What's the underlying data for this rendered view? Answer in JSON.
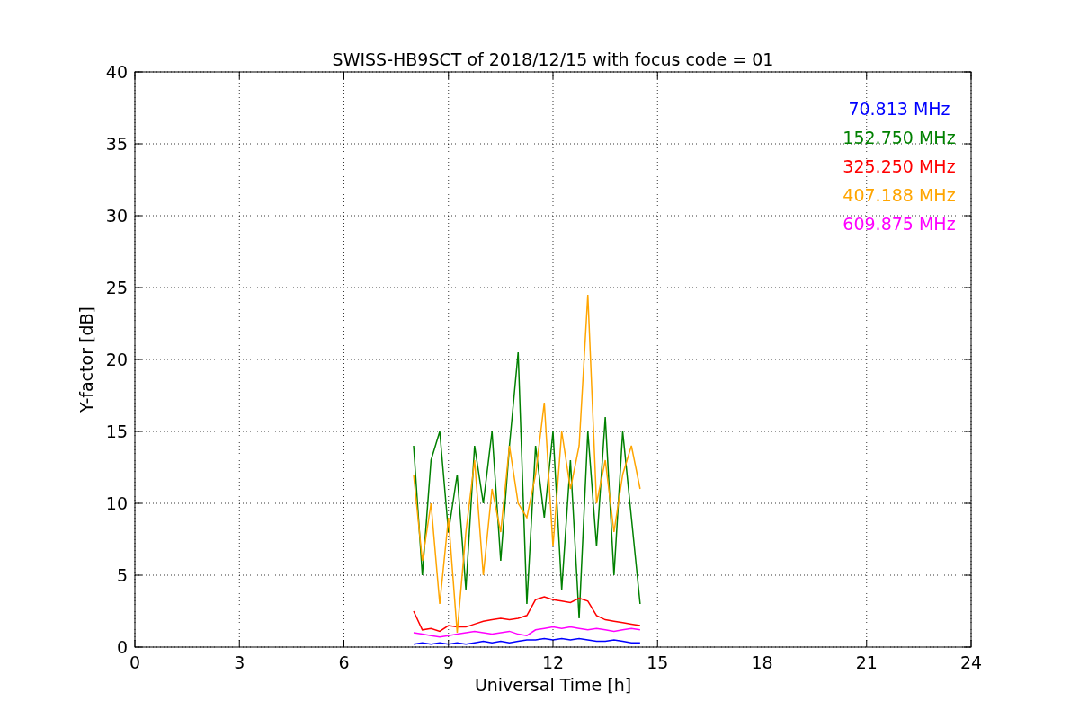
{
  "chart_data": {
    "type": "line",
    "title": "SWISS-HB9SCT of 2018/12/15 with focus code = 01",
    "xlabel": "Universal Time [h]",
    "ylabel": "Y-factor [dB]",
    "xlim": [
      0,
      24
    ],
    "ylim": [
      0,
      40
    ],
    "xticks": [
      0,
      3,
      6,
      9,
      12,
      15,
      18,
      21,
      24
    ],
    "yticks": [
      0,
      5,
      10,
      15,
      20,
      25,
      30,
      35,
      40
    ],
    "grid": true,
    "x": [
      8,
      8.25,
      8.5,
      8.75,
      9,
      9.25,
      9.5,
      9.75,
      10,
      10.25,
      10.5,
      10.75,
      11,
      11.25,
      11.5,
      11.75,
      12,
      12.25,
      12.5,
      12.75,
      13,
      13.25,
      13.5,
      13.75,
      14,
      14.25,
      14.5
    ],
    "series": [
      {
        "name": "70.813 MHz",
        "color": "#0000ff",
        "values": [
          0.2,
          0.3,
          0.2,
          0.3,
          0.2,
          0.3,
          0.2,
          0.3,
          0.4,
          0.3,
          0.4,
          0.3,
          0.4,
          0.5,
          0.5,
          0.6,
          0.5,
          0.6,
          0.5,
          0.6,
          0.5,
          0.4,
          0.4,
          0.5,
          0.4,
          0.3,
          0.3
        ]
      },
      {
        "name": "152.750 MHz",
        "color": "#008000",
        "values": [
          14,
          5,
          13,
          15,
          8,
          12,
          4,
          14,
          10,
          15,
          6,
          14,
          20.5,
          3,
          14,
          9,
          15,
          4,
          13,
          2,
          15,
          7,
          16,
          5,
          15,
          9,
          3
        ]
      },
      {
        "name": "325.250 MHz",
        "color": "#ff0000",
        "values": [
          2.5,
          1.2,
          1.3,
          1.1,
          1.5,
          1.4,
          1.4,
          1.6,
          1.8,
          1.9,
          2.0,
          1.9,
          2.0,
          2.2,
          3.3,
          3.5,
          3.3,
          3.2,
          3.1,
          3.4,
          3.2,
          2.2,
          1.9,
          1.8,
          1.7,
          1.6,
          1.5
        ]
      },
      {
        "name": "407.188 MHz",
        "color": "#ffa500",
        "values": [
          12,
          6,
          10,
          3,
          9,
          1,
          8,
          13,
          5,
          11,
          8,
          14,
          10,
          9,
          12,
          17,
          7,
          15,
          11,
          14,
          24.5,
          10,
          13,
          8,
          12,
          14,
          11
        ]
      },
      {
        "name": "609.875 MHz",
        "color": "#ff00ff",
        "values": [
          1,
          0.9,
          0.8,
          0.7,
          0.8,
          0.9,
          1.0,
          1.1,
          1.0,
          0.9,
          1.0,
          1.1,
          0.9,
          0.8,
          1.2,
          1.3,
          1.4,
          1.3,
          1.4,
          1.3,
          1.2,
          1.3,
          1.2,
          1.1,
          1.2,
          1.3,
          1.2
        ]
      }
    ]
  }
}
